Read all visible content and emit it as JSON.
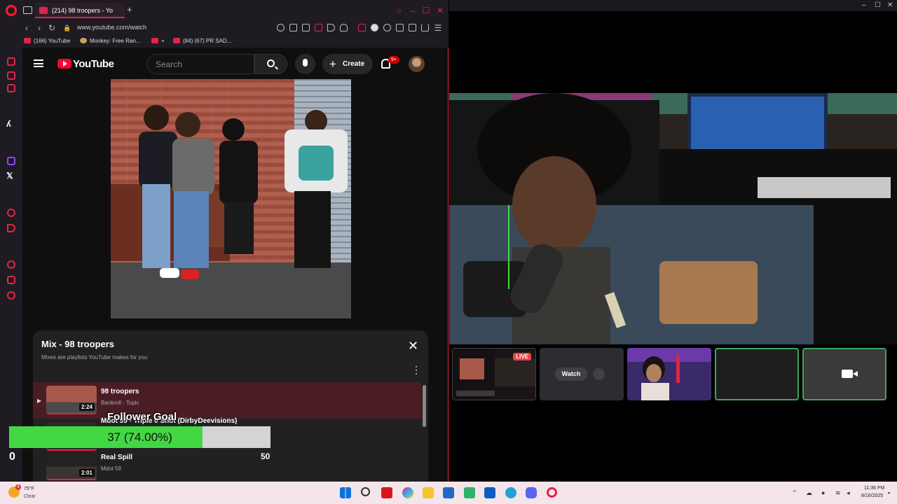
{
  "browser": {
    "active_tab": "(214) 98 troopers - Yo",
    "url": "www.youtube.com/watch",
    "bookmarks": [
      "(166) YouTube",
      "Monkey: Free Ran...",
      "+",
      "(84) (67) PR SAD..."
    ]
  },
  "youtube": {
    "logo": "YouTube",
    "search_placeholder": "Search",
    "create_label": "Create",
    "notification_count": "9+"
  },
  "mix": {
    "title": "Mix - 98 troopers",
    "subtitle": "Mixes are playlists YouTube makes for you",
    "items": [
      {
        "title": "98 troopers",
        "artist": "Bankroll - Topic",
        "duration": "2:24"
      },
      {
        "title": "Mdot 59 - Triple 0 Shot (DirbyDeevisions)",
        "artist": "",
        "duration": ""
      },
      {
        "title": "Real Spill",
        "artist": "Mdot 59",
        "duration": "2:01"
      }
    ]
  },
  "follower_goal": {
    "title": "Follower Goal",
    "progress_text": "37 (74.00%)",
    "progress_fraction": 0.74,
    "min": "0",
    "max": "50"
  },
  "discord": {
    "live_label": "LIVE",
    "watch_label": "Watch"
  },
  "taskbar": {
    "temperature": "75°F",
    "condition": "Clear",
    "weather_badge": "4",
    "time": "11:36 PM",
    "date": "8/16/2025"
  },
  "colors": {
    "opera_accent": "#e0244a",
    "youtube_red": "#ff0033",
    "goal_green": "#43d843",
    "discord_green": "#3ba55d"
  }
}
